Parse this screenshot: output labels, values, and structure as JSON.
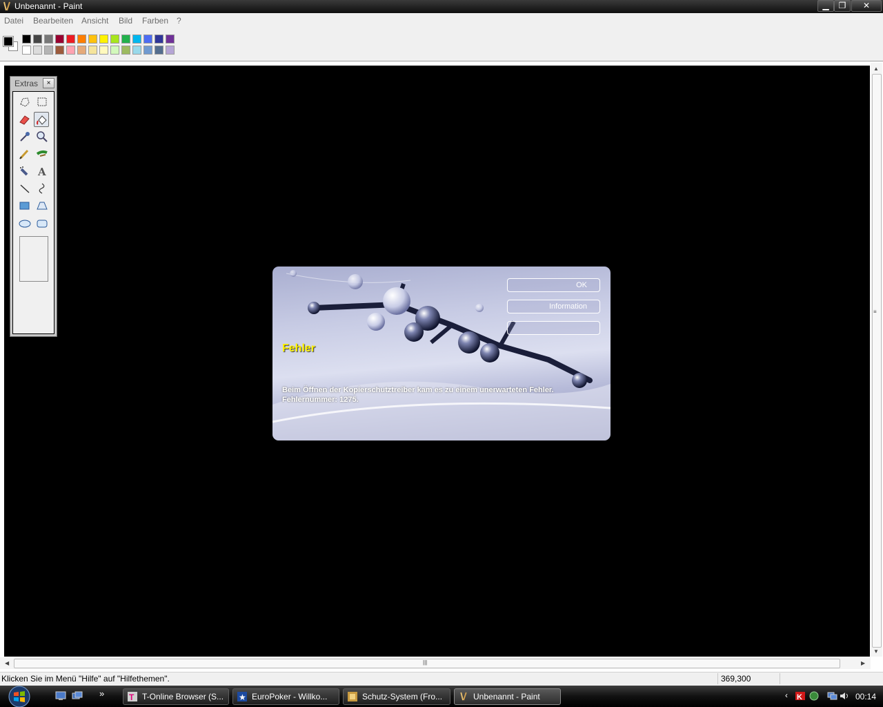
{
  "window": {
    "title": "Unbenannt - Paint"
  },
  "menu": {
    "items": [
      "Datei",
      "Bearbeiten",
      "Ansicht",
      "Bild",
      "Farben",
      "?"
    ]
  },
  "palette": {
    "foreground": "#000000",
    "background": "#ffffff",
    "row1": [
      "#000000",
      "#464646",
      "#787878",
      "#990030",
      "#ed1c24",
      "#ff7e00",
      "#ffc20e",
      "#fff200",
      "#a8e61d",
      "#22b14c",
      "#00b7ef",
      "#4d6df3",
      "#2f3699",
      "#6f3198"
    ],
    "row2": [
      "#ffffff",
      "#dcdcdc",
      "#b4b4b4",
      "#9c5a3c",
      "#ffa3b1",
      "#e5aa7a",
      "#f5e49c",
      "#fff9bd",
      "#d3f9bc",
      "#9dbb61",
      "#99d9ea",
      "#709ad1",
      "#546d8e",
      "#b5a5d5"
    ]
  },
  "tools": {
    "title": "Extras",
    "close_label": "×",
    "items": [
      "free-select",
      "rect-select",
      "eraser",
      "fill",
      "color-picker",
      "magnifier",
      "pencil",
      "brush",
      "airbrush",
      "text",
      "line",
      "curve",
      "rectangle",
      "polygon",
      "ellipse",
      "rounded-rectangle"
    ],
    "active": "fill"
  },
  "dialog": {
    "title": "Fehler",
    "message": "Beim Öffnen der Kopierschutztreiber kam es zu einem unerwarteten Fehler.\nFehlernummer: 1275.",
    "buttons": {
      "ok": "OK",
      "info": "Information",
      "third": ""
    }
  },
  "status": {
    "text": "Klicken Sie im Menü \"Hilfe\" auf \"Hilfethemen\".",
    "coords": "369,300"
  },
  "taskbar": {
    "items": [
      {
        "label": "T-Online Browser (S..."
      },
      {
        "label": "EuroPoker - Willko..."
      },
      {
        "label": "Schutz-System (Fro..."
      },
      {
        "label": "Unbenannt - Paint"
      }
    ],
    "quicklaunch_more": "»",
    "clock": "00:14"
  }
}
